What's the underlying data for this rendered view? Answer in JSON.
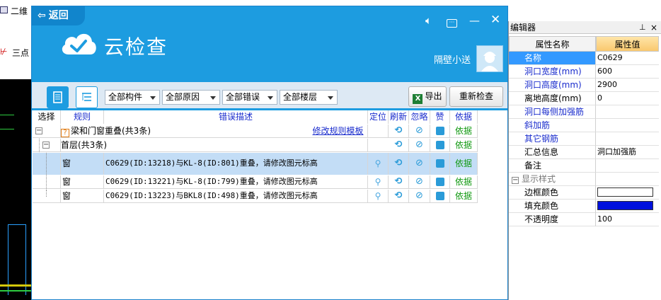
{
  "background_app": {
    "view_2d_label": "二维",
    "three_point_label": "三点"
  },
  "property_editor": {
    "title": "编辑器",
    "pin_icon": "pin-icon",
    "close_label": "×",
    "header": {
      "name_col": "属性名称",
      "value_col": "属性值"
    },
    "rows": [
      {
        "name": "名称",
        "value": "C0629"
      },
      {
        "name": "洞口宽度(mm)",
        "value": "600"
      },
      {
        "name": "洞口高度(mm)",
        "value": "2900"
      },
      {
        "name": "离地高度(mm)",
        "value": "0"
      },
      {
        "name": "洞口每侧加强筋",
        "value": ""
      },
      {
        "name": "斜加筋",
        "value": ""
      },
      {
        "name": "其它钢筋",
        "value": ""
      },
      {
        "name": "汇总信息",
        "value": "洞口加强筋"
      },
      {
        "name": "备注",
        "value": ""
      },
      {
        "name": "显示样式",
        "value": ""
      },
      {
        "name": "边框颜色",
        "value": ""
      },
      {
        "name": "填充颜色",
        "value": ""
      },
      {
        "name": "不透明度",
        "value": "100"
      }
    ],
    "colors": {
      "border_color": "#ffffff",
      "fill_color": "#0011dd"
    }
  },
  "dialog": {
    "back_label": "返回",
    "title": "云检查",
    "user_name": "隔壁小送",
    "accent": "#1d9ce0",
    "toolbar": {
      "filters": [
        "全部构件",
        "全部原因",
        "全部错误",
        "全部楼层"
      ],
      "export_label": "导出",
      "recheck_label": "重新检查"
    },
    "table": {
      "headers": [
        "选择",
        "规则",
        "错误描述",
        "定位",
        "刷新",
        "忽略",
        "赞",
        "依据"
      ],
      "group_row": {
        "label": "梁和门窗重叠(共3条)",
        "link": "修改规则模板",
        "basis": "依据"
      },
      "floor_row": {
        "label": "首层(共3条)",
        "basis": "依据"
      },
      "items": [
        {
          "rule": "窗",
          "description": "C0629(ID:13218)与KL-8(ID:801)重叠，请修改图元标高",
          "basis": "依据"
        },
        {
          "rule": "窗",
          "description": "C0629(ID:13221)与KL-8(ID:799)重叠，请修改图元标高",
          "basis": "依据"
        },
        {
          "rule": "窗",
          "description": "C0629(ID:13223)与BKL8(ID:498)重叠，请修改图元标高",
          "basis": "依据"
        }
      ]
    }
  }
}
